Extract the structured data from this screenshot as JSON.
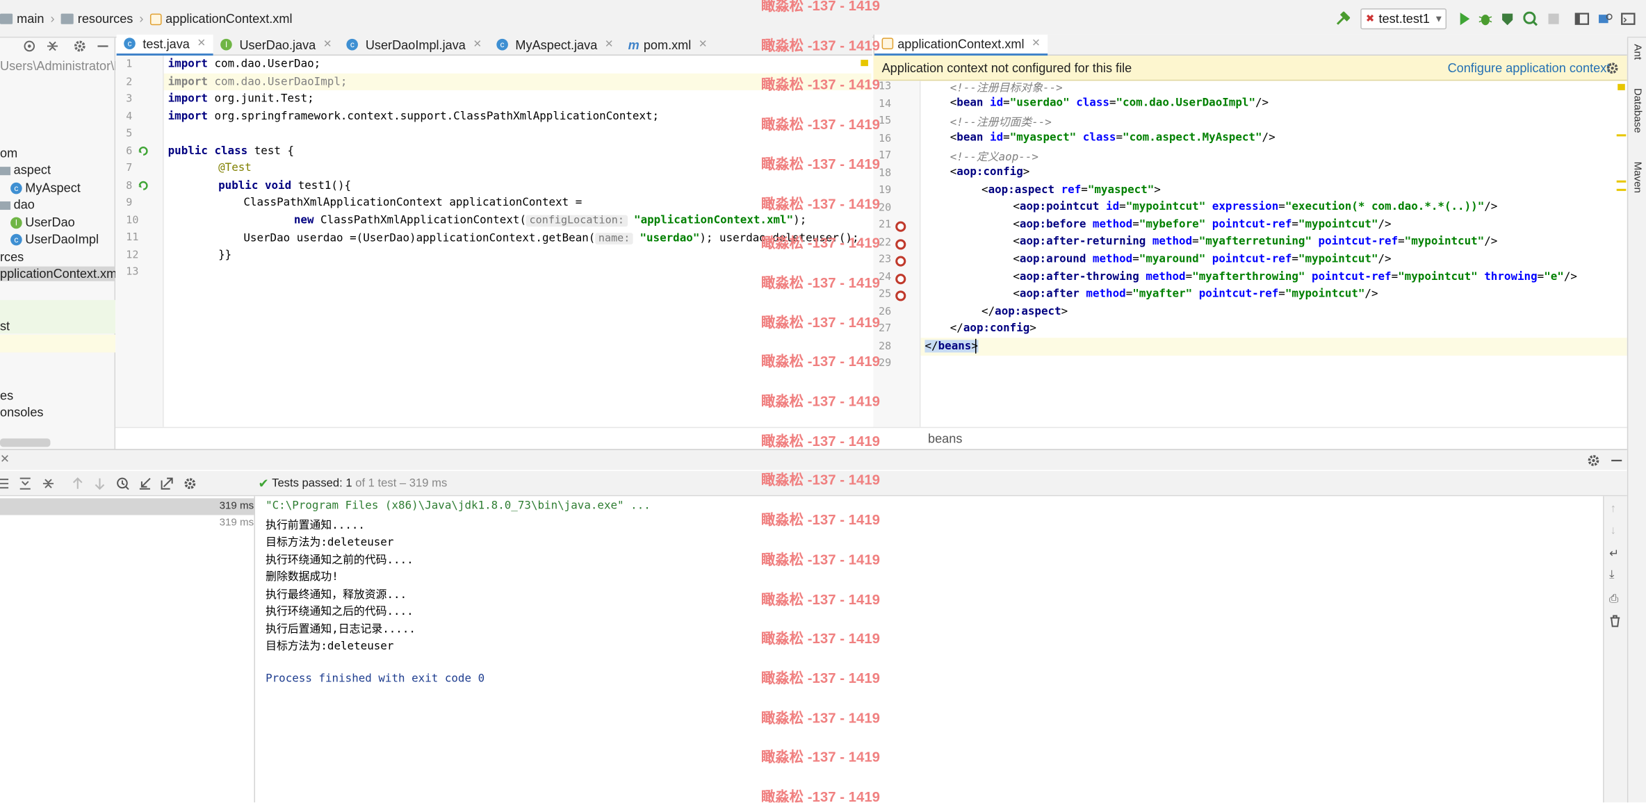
{
  "navbar": {
    "crumbs": [
      "main",
      "resources",
      "applicationContext.xml"
    ],
    "run_config": "test.test1"
  },
  "project": {
    "path": "Users\\Administrator\\De",
    "items": [
      {
        "label": "om",
        "type": "text"
      },
      {
        "label": "aspect",
        "type": "folder"
      },
      {
        "label": "MyAspect",
        "type": "class"
      },
      {
        "label": "dao",
        "type": "folder"
      },
      {
        "label": "UserDao",
        "type": "interface"
      },
      {
        "label": "UserDaoImpl",
        "type": "class"
      },
      {
        "label": "rces",
        "type": "text"
      },
      {
        "label": "pplicationContext.xml",
        "type": "xml"
      },
      {
        "label": "st",
        "type": "text"
      },
      {
        "label": "es",
        "type": "text"
      },
      {
        "label": "onsoles",
        "type": "text"
      }
    ]
  },
  "tabs_left": [
    {
      "label": "test.java",
      "icon": "C",
      "active": true
    },
    {
      "label": "UserDao.java",
      "icon": "I",
      "active": false
    },
    {
      "label": "UserDaoImpl.java",
      "icon": "C",
      "active": false
    },
    {
      "label": "MyAspect.java",
      "icon": "C",
      "active": false
    },
    {
      "label": "pom.xml",
      "icon": "m",
      "active": false
    }
  ],
  "tabs_right": [
    {
      "label": "applicationContext.xml",
      "active": true
    }
  ],
  "java_lines": [
    "1",
    "2",
    "3",
    "4",
    "5",
    "6",
    "7",
    "8",
    "9",
    "10",
    "11",
    "12",
    "13"
  ],
  "java_code": {
    "l1_kw": "import",
    "l1": " com.dao.UserDao;",
    "l2_kw": "import",
    "l2": " com.dao.UserDaoImpl;",
    "l3_kw": "import",
    "l3": " org.junit.Test;",
    "l4_kw": "import",
    "l4": " org.springframework.context.support.ClassPathXmlApplicationContext;",
    "l6_kw": "public class",
    "l6": " test {",
    "l7": "@Test",
    "l8_kw": "public void",
    "l8": " test1(){",
    "l9": "ClassPathXmlApplicationContext applicationContext =",
    "l10_kw": "new",
    "l10_a": " ClassPathXmlApplicationContext(",
    "l10_hint": "configLocation:",
    "l10_str": "\"applicationContext.xml\"",
    "l10_b": ");",
    "l11_a": "UserDao userdao =(UserDao)applicationContext.getBean(",
    "l11_hint": "name:",
    "l11_str": "\"userdao\"",
    "l11_b": "); userdao.deleteuser();",
    "l12": "}}"
  },
  "xml_banner": {
    "message": "Application context not configured for this file",
    "link": "Configure application context"
  },
  "xml_lines": [
    "13",
    "14",
    "15",
    "16",
    "17",
    "18",
    "19",
    "20",
    "21",
    "22",
    "23",
    "24",
    "25",
    "26",
    "27",
    "28",
    "29"
  ],
  "xml_code": {
    "c13": "<!--注册目标对象-->",
    "l14": {
      "tag": "bean",
      "a1": "id",
      "v1": "\"userdao\"",
      "a2": "class",
      "v2": "\"com.dao.UserDaoImpl\""
    },
    "c15": "<!--注册切面类-->",
    "l16": {
      "tag": "bean",
      "a1": "id",
      "v1": "\"myaspect\"",
      "a2": "class",
      "v2": "\"com.aspect.MyAspect\""
    },
    "c17": "<!--定义aop-->",
    "l18": "aop:config",
    "l19": {
      "tag": "aop:aspect",
      "a1": "ref",
      "v1": "\"myaspect\""
    },
    "l20": {
      "tag": "aop:pointcut",
      "a1": "id",
      "v1": "\"mypointcut\"",
      "a2": "expression",
      "v2": "\"execution(* com.dao.*.*(..))\""
    },
    "l21": {
      "tag": "aop:before",
      "a1": "method",
      "v1": "\"mybefore\"",
      "a2": "pointcut-ref",
      "v2": "\"mypointcut\""
    },
    "l22": {
      "tag": "aop:after-returning",
      "a1": "method",
      "v1": "\"myafterretuning\"",
      "a2": "pointcut-ref",
      "v2": "\"mypointcut\""
    },
    "l23": {
      "tag": "aop:around",
      "a1": "method",
      "v1": "\"myaround\"",
      "a2": "pointcut-ref",
      "v2": "\"mypointcut\""
    },
    "l24": {
      "tag": "aop:after-throwing",
      "a1": "method",
      "v1": "\"myafterthrowing\"",
      "a2": "pointcut-ref",
      "v2": "\"mypointcut\"",
      "a3": "throwing",
      "v3": "\"e\""
    },
    "l25": {
      "tag": "aop:after",
      "a1": "method",
      "v1": "\"myafter\"",
      "a2": "pointcut-ref",
      "v2": "\"mypointcut\""
    },
    "l26": "aop:aspect",
    "l27": "aop:config",
    "l28": "beans"
  },
  "xml_breadcrumb": "beans",
  "run": {
    "status_prefix": "Tests passed: ",
    "status_count": "1",
    "status_suffix": " of 1 test – 319 ms",
    "left_time_1": "319 ms",
    "left_time_2": "319 ms",
    "console": [
      "\"C:\\Program Files (x86)\\Java\\jdk1.8.0_73\\bin\\java.exe\" ...",
      "执行前置通知.....",
      "目标方法为:deleteuser",
      "执行环绕通知之前的代码....",
      "删除数据成功!",
      "执行最终通知，释放资源...",
      "执行环绕通知之后的代码....",
      "执行后置通知,日志记录.....",
      "目标方法为:deleteuser",
      "",
      "Process finished with exit code 0"
    ]
  },
  "right_strip": [
    "Ant",
    "Database",
    "Maven"
  ],
  "watermark": "瞰淼松 -137 - 1419",
  "colors": {
    "keyword": "#000080",
    "string": "#008000",
    "attr": "#0000ff",
    "watermark": "#f08080",
    "banner": "#fdf6cf"
  }
}
